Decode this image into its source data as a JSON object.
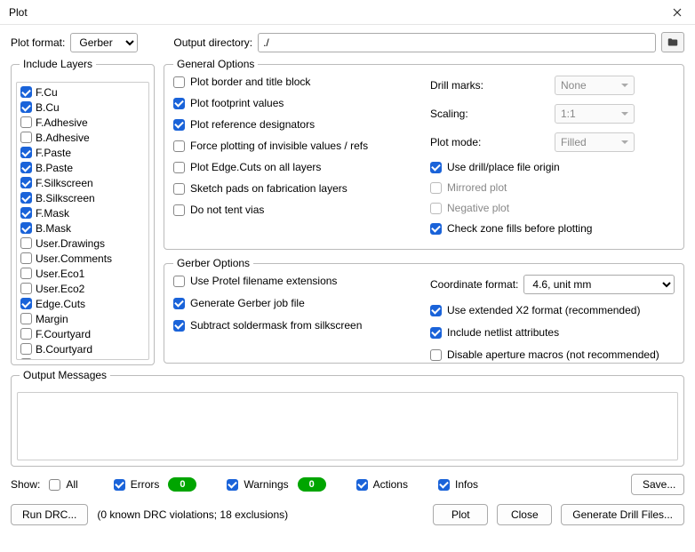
{
  "window": {
    "title": "Plot"
  },
  "plotFormat": {
    "label": "Plot format:",
    "value": "Gerber"
  },
  "outputDir": {
    "label": "Output directory:",
    "value": "./"
  },
  "layers": {
    "legend": "Include Layers",
    "items": [
      {
        "label": "F.Cu",
        "checked": true
      },
      {
        "label": "B.Cu",
        "checked": true
      },
      {
        "label": "F.Adhesive",
        "checked": false
      },
      {
        "label": "B.Adhesive",
        "checked": false
      },
      {
        "label": "F.Paste",
        "checked": true
      },
      {
        "label": "B.Paste",
        "checked": true
      },
      {
        "label": "F.Silkscreen",
        "checked": true
      },
      {
        "label": "B.Silkscreen",
        "checked": true
      },
      {
        "label": "F.Mask",
        "checked": true
      },
      {
        "label": "B.Mask",
        "checked": true
      },
      {
        "label": "User.Drawings",
        "checked": false
      },
      {
        "label": "User.Comments",
        "checked": false
      },
      {
        "label": "User.Eco1",
        "checked": false
      },
      {
        "label": "User.Eco2",
        "checked": false
      },
      {
        "label": "Edge.Cuts",
        "checked": true
      },
      {
        "label": "Margin",
        "checked": false
      },
      {
        "label": "F.Courtyard",
        "checked": false
      },
      {
        "label": "B.Courtyard",
        "checked": false
      },
      {
        "label": "F.Fab",
        "checked": false
      }
    ]
  },
  "general": {
    "legend": "General Options",
    "left": [
      {
        "label": "Plot border and title block",
        "checked": false
      },
      {
        "label": "Plot footprint values",
        "checked": true
      },
      {
        "label": "Plot reference designators",
        "checked": true
      },
      {
        "label": "Force plotting of invisible values / refs",
        "checked": false
      },
      {
        "label": "Plot Edge.Cuts on all layers",
        "checked": false
      },
      {
        "label": "Sketch pads on fabrication layers",
        "checked": false
      },
      {
        "label": "Do not tent vias",
        "checked": false
      }
    ],
    "drillMarks": {
      "label": "Drill marks:",
      "value": "None"
    },
    "scaling": {
      "label": "Scaling:",
      "value": "1:1"
    },
    "plotMode": {
      "label": "Plot mode:",
      "value": "Filled"
    },
    "right": [
      {
        "label": "Use drill/place file origin",
        "checked": true,
        "disabled": false
      },
      {
        "label": "Mirrored plot",
        "checked": false,
        "disabled": true
      },
      {
        "label": "Negative plot",
        "checked": false,
        "disabled": true
      },
      {
        "label": "Check zone fills before plotting",
        "checked": true,
        "disabled": false
      }
    ]
  },
  "gerber": {
    "legend": "Gerber Options",
    "left": [
      {
        "label": "Use Protel filename extensions",
        "checked": false
      },
      {
        "label": "Generate Gerber job file",
        "checked": true
      },
      {
        "label": "Subtract soldermask from silkscreen",
        "checked": true
      }
    ],
    "coord": {
      "label": "Coordinate format:",
      "value": "4.6, unit mm"
    },
    "right": [
      {
        "label": "Use extended X2 format (recommended)",
        "checked": true
      },
      {
        "label": "Include netlist attributes",
        "checked": true
      },
      {
        "label": "Disable aperture macros (not recommended)",
        "checked": false
      }
    ]
  },
  "output": {
    "legend": "Output Messages"
  },
  "show": {
    "label": "Show:",
    "all": {
      "label": "All",
      "checked": false
    },
    "errors": {
      "label": "Errors",
      "checked": true,
      "count": "0"
    },
    "warnings": {
      "label": "Warnings",
      "checked": true,
      "count": "0"
    },
    "actions": {
      "label": "Actions",
      "checked": true
    },
    "infos": {
      "label": "Infos",
      "checked": true
    },
    "save": "Save..."
  },
  "bottom": {
    "runDrc": "Run DRC...",
    "status": "(0 known DRC violations; 18 exclusions)",
    "plot": "Plot",
    "close": "Close",
    "genDrill": "Generate Drill Files..."
  }
}
